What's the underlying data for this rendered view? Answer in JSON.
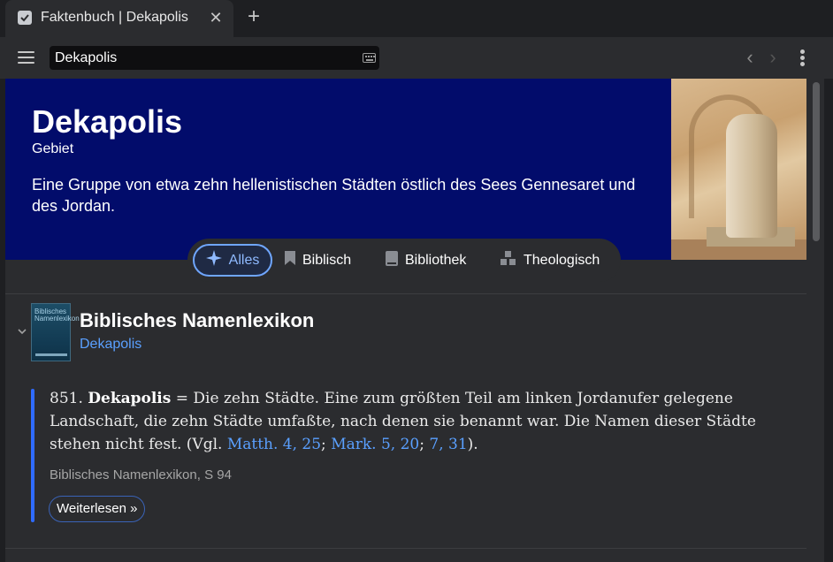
{
  "browser": {
    "tab_title": "Faktenbuch | Dekapolis",
    "tab_close": "✕",
    "new_tab": "+"
  },
  "toolbar": {
    "search_value": "Dekapolis",
    "back": "‹",
    "forward": "›"
  },
  "hero": {
    "title": "Dekapolis",
    "subtitle": "Gebiet",
    "description": "Eine Gruppe von etwa zehn hellenistischen Städten östlich des Sees Gennesaret und des Jordan."
  },
  "filters": [
    {
      "label": "Alles",
      "icon": "sparkle-icon",
      "active": true
    },
    {
      "label": "Biblisch",
      "icon": "bookmark-icon"
    },
    {
      "label": "Bibliothek",
      "icon": "book-icon"
    },
    {
      "label": "Theologisch",
      "icon": "blocks-icon"
    }
  ],
  "lexicon": {
    "title": "Biblisches Namenlexikon",
    "link": "Dekapolis",
    "cover_title": "Biblisches Namenlexikon",
    "entry": {
      "number": "851.",
      "term": "Dekapolis",
      "eq": "=",
      "text": "Die zehn Städte. Eine zum größten Teil am linken Jordanufer gelegene Landschaft, die zehn Städte umfaßte, nach denen sie benannt war. Die Namen dieser Städte stehen nicht fest. (Vgl.",
      "refs": [
        "Matth. 4, 25",
        "Mark. 5, 20",
        "7, 31"
      ],
      "sep": ";",
      "close": ")."
    },
    "source": "Biblisches Namenlexikon, S 94",
    "read_more": "Weiterlesen »"
  },
  "colors": {
    "hero_bg": "#020c6b",
    "accent": "#5aa0ff",
    "panel": "#2b2c2f"
  }
}
